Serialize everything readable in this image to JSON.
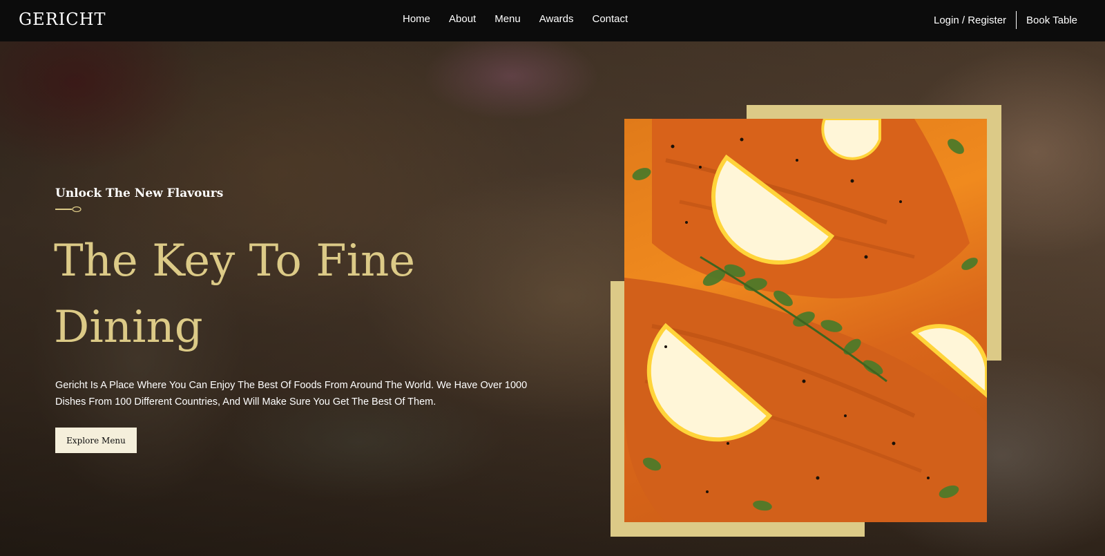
{
  "brand": {
    "logo": "GERICHT"
  },
  "nav": {
    "links": [
      "Home",
      "About",
      "Menu",
      "Awards",
      "Contact"
    ],
    "login": "Login / Register",
    "book": "Book Table"
  },
  "hero": {
    "subtitle": "Unlock The New Flavours",
    "headline_line1": "The Key To Fine",
    "headline_line2": "Dining",
    "description": "Gericht Is A Place Where You Can Enjoy The Best Of Foods From Around The World. We Have Over 1000 Dishes From 100 Different Countries, And Will Make Sure You Get The Best Of Them.",
    "button": "Explore Menu"
  },
  "colors": {
    "accent": "#dcca87",
    "navbar": "#0c0c0c",
    "button_bg": "#f5efdb",
    "text": "#ffffff"
  },
  "icons": {
    "spoon": "spoon-icon"
  }
}
